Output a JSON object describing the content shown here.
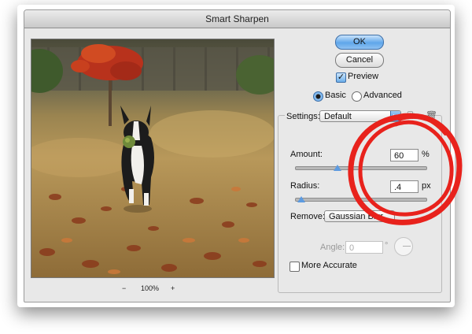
{
  "window": {
    "title": "Smart Sharpen"
  },
  "preview": {
    "zoom_minus": "−",
    "zoom_level": "100%",
    "zoom_plus": "+"
  },
  "buttons": {
    "ok": "OK",
    "cancel": "Cancel"
  },
  "preview_checkbox": {
    "label": "Preview",
    "checked": true
  },
  "mode": {
    "basic": "Basic",
    "advanced": "Advanced",
    "selected": "Basic"
  },
  "settings": {
    "label": "Settings:",
    "value": "Default"
  },
  "amount": {
    "label": "Amount:",
    "value": "60",
    "unit": "%",
    "slider_level": 0.3
  },
  "radius": {
    "label": "Radius:",
    "value": ".4",
    "unit": "px",
    "slider_level": 0.04
  },
  "remove": {
    "label": "Remove:",
    "value": "Gaussian Blur"
  },
  "angle": {
    "label": "Angle:",
    "value": "0",
    "unit": "°"
  },
  "more_accurate": {
    "label": "More Accurate",
    "checked": false
  },
  "colors": {
    "annotation": "#e8221c",
    "accent": "#5fa6ea"
  }
}
